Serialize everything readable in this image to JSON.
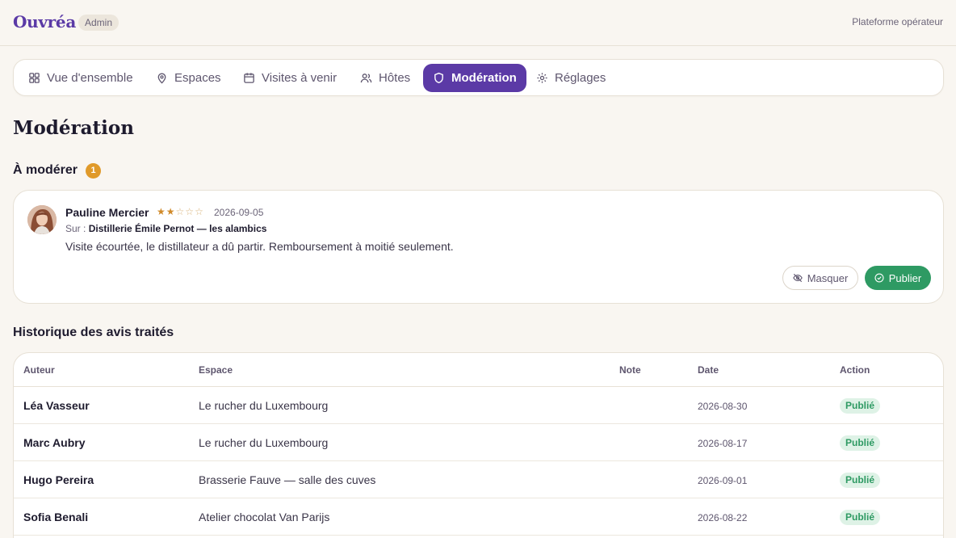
{
  "header": {
    "brand": "Ouvréa",
    "role_badge": "Admin",
    "platform_label": "Plateforme opérateur"
  },
  "nav": {
    "tabs": [
      {
        "label": "Vue d'ensemble",
        "icon": "grid-icon",
        "active": false
      },
      {
        "label": "Espaces",
        "icon": "map-pin-icon",
        "active": false
      },
      {
        "label": "Visites à venir",
        "icon": "calendar-icon",
        "active": false
      },
      {
        "label": "Hôtes",
        "icon": "users-icon",
        "active": false
      },
      {
        "label": "Modération",
        "icon": "shield-icon",
        "active": true
      },
      {
        "label": "Réglages",
        "icon": "gear-icon",
        "active": false
      }
    ]
  },
  "page": {
    "title": "Modération"
  },
  "pending": {
    "title": "À modérer",
    "count": "1",
    "review": {
      "author": "Pauline Mercier",
      "rating": 2,
      "rating_max": 5,
      "stars": "★★☆☆☆",
      "date": "2026-09-05",
      "space_prefix": "Sur :",
      "space": "Distillerie Émile Pernot — les alambics",
      "text": "Visite écourtée, le distillateur a dû partir. Remboursement à moitié seulement.",
      "hide_label": "Masquer",
      "publish_label": "Publier"
    }
  },
  "history": {
    "title": "Historique des avis traités",
    "columns": [
      "Auteur",
      "Espace",
      "Note",
      "Date",
      "Action"
    ],
    "rows": [
      {
        "author": "Léa Vasseur",
        "space": "Le rucher du Luxembourg",
        "note": "",
        "date": "2026-08-30",
        "action": "Publié"
      },
      {
        "author": "Marc Aubry",
        "space": "Le rucher du Luxembourg",
        "note": "",
        "date": "2026-08-17",
        "action": "Publié"
      },
      {
        "author": "Hugo Pereira",
        "space": "Brasserie Fauve — salle des cuves",
        "note": "",
        "date": "2026-09-01",
        "action": "Publié"
      },
      {
        "author": "Sofia Benali",
        "space": "Atelier chocolat Van Parijs",
        "note": "",
        "date": "2026-08-22",
        "action": "Publié"
      }
    ]
  },
  "colors": {
    "accent": "#5b3aa6",
    "success": "#2e9a63",
    "badge": "#e09a2a",
    "background": "#f9f6f1"
  }
}
